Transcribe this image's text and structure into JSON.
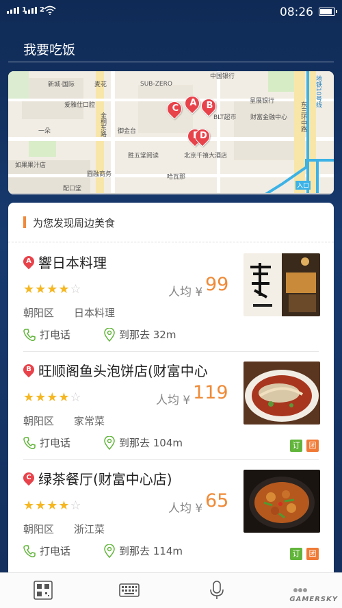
{
  "status_bar": {
    "signal1": "1",
    "signal2": "2",
    "time": "08:26"
  },
  "header": {
    "title": "我要吃饭"
  },
  "map": {
    "labels": [
      "中国银行",
      "新城·国际",
      "麦花",
      "SUB-ZERO",
      "爱雅仕口腔",
      "呈展银行",
      "BLT超市",
      "财富金融中心",
      "一朵",
      "御金台",
      "胜五堂阅读",
      "北京千禧大酒店",
      "如果果汁店",
      "圆融商务",
      "哈瓦那",
      "配口堂",
      "东三环中路",
      "金桐东路",
      "地铁10号线",
      "入口"
    ],
    "pins": [
      "A",
      "B",
      "C",
      "D",
      "E"
    ]
  },
  "list": {
    "heading": "为您发现周边美食",
    "per_capita_label": "人均",
    "currency": "¥",
    "call_label": "打电话",
    "items": [
      {
        "marker": "A",
        "name": "響日本料理",
        "rating": 4,
        "price": "99",
        "region": "朝阳区",
        "category": "日本料理",
        "distance": "到那去 32m",
        "tags": []
      },
      {
        "marker": "B",
        "name": "旺顺阁鱼头泡饼店(财富中心",
        "rating": 4,
        "price": "119",
        "region": "朝阳区",
        "category": "家常菜",
        "distance": "到那去 104m",
        "tags": [
          "订",
          "团"
        ]
      },
      {
        "marker": "C",
        "name": "绿茶餐厅(财富中心店)",
        "rating": 4,
        "price": "65",
        "region": "朝阳区",
        "category": "浙江菜",
        "distance": "到那去 114m",
        "tags": [
          "订",
          "团"
        ]
      }
    ]
  },
  "bottom_bar": {
    "icons": [
      "qr-scan-icon",
      "keyboard-icon",
      "microphone-icon",
      "more-icon"
    ]
  },
  "watermark": "GAMERSKY",
  "colors": {
    "accent": "#ef8a37",
    "pin": "#e8424a",
    "star": "#f5b722",
    "ding": "#62b53b",
    "tuan": "#f07a35"
  }
}
